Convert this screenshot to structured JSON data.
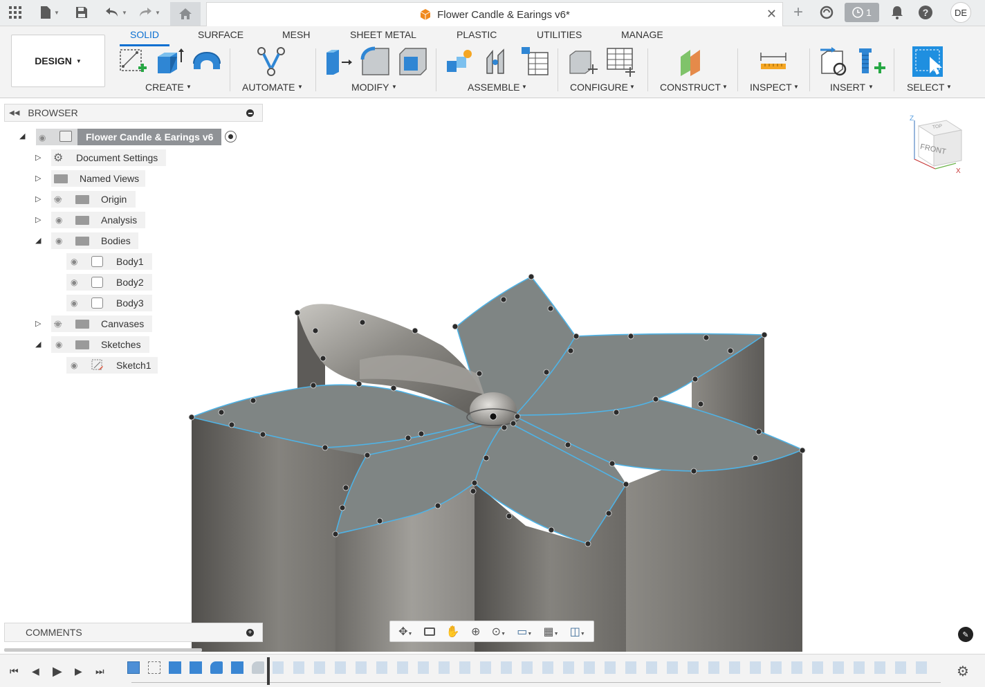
{
  "title_bar": {
    "document_title": "Flower Candle & Earings v6*",
    "job_count": "1",
    "user_initials": "DE"
  },
  "workspace": {
    "label": "DESIGN"
  },
  "tabs": [
    "SOLID",
    "SURFACE",
    "MESH",
    "SHEET METAL",
    "PLASTIC",
    "UTILITIES",
    "MANAGE"
  ],
  "groups": [
    "CREATE",
    "AUTOMATE",
    "MODIFY",
    "ASSEMBLE",
    "CONFIGURE",
    "CONSTRUCT",
    "INSPECT",
    "INSERT",
    "SELECT"
  ],
  "browser": {
    "header": "BROWSER",
    "root": "Flower Candle & Earings v6",
    "items": [
      "Document Settings",
      "Named Views",
      "Origin",
      "Analysis",
      "Bodies",
      "Body1",
      "Body2",
      "Body3",
      "Canvases",
      "Sketches",
      "Sketch1"
    ]
  },
  "comments": {
    "header": "COMMENTS"
  },
  "viewcube": {
    "top": "TOP",
    "front": "FRONT",
    "axis_x": "X",
    "axis_z": "Z"
  },
  "colors": {
    "accent": "#0a6fd1",
    "sketch_line": "#4fb3e6",
    "body": "#7e7c78"
  }
}
